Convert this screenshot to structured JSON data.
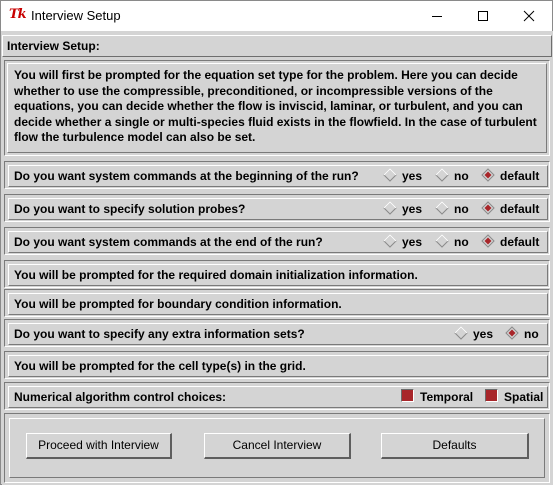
{
  "window": {
    "title": "Interview Setup",
    "icon_text": "Tk"
  },
  "header": {
    "label": "Interview Setup:"
  },
  "intro": {
    "text": "You will first be prompted for the equation set type for the problem.  Here you can decide whether to use the compressible, preconditioned, or incompressible versions of the equations, you can decide whether the flow is inviscid, laminar, or turbulent, and you can decide whether a single or multi-species fluid exists in the flowfield.  In the case of turbulent flow the turbulence model can also be set."
  },
  "questions": [
    {
      "text": "Do you want system commands at the beginning of the run?",
      "options": [
        "yes",
        "no",
        "default"
      ],
      "selected": "default"
    },
    {
      "text": "Do you want to specify solution probes?",
      "options": [
        "yes",
        "no",
        "default"
      ],
      "selected": "default"
    },
    {
      "text": "Do you want system commands at the end of the run?",
      "options": [
        "yes",
        "no",
        "default"
      ],
      "selected": "default"
    },
    {
      "text": "You will be prompted for the required domain initialization information."
    },
    {
      "text": "You will be prompted for boundary condition information."
    },
    {
      "text": "Do you want to specify any extra information sets?",
      "options": [
        "yes",
        "no"
      ],
      "selected": "no"
    },
    {
      "text": "You will be prompted for the cell type(s) in the grid."
    },
    {
      "text": "Numerical algorithm control choices:",
      "checkboxes": [
        {
          "label": "Temporal",
          "checked": true
        },
        {
          "label": "Spatial",
          "checked": true
        }
      ]
    }
  ],
  "buttons": {
    "proceed": "Proceed with Interview",
    "cancel": "Cancel Interview",
    "defaults": "Defaults"
  },
  "colors": {
    "selected_indicator": "#a8262a",
    "background": "#d4d4d4"
  }
}
